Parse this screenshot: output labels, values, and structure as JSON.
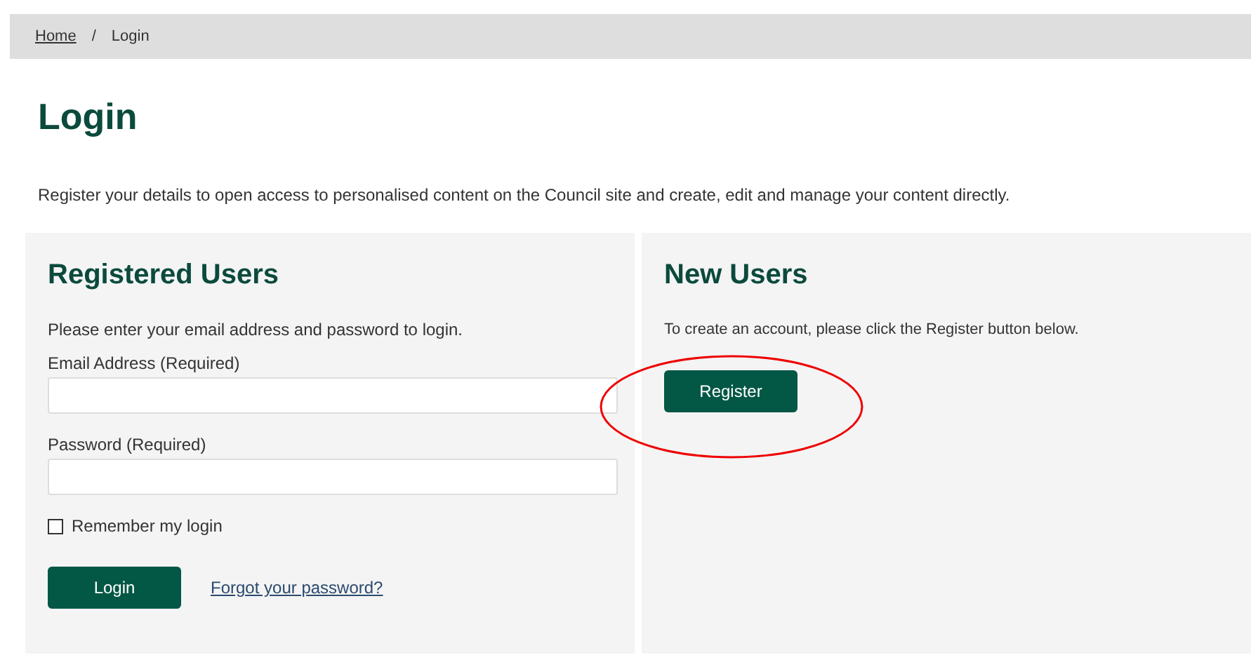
{
  "breadcrumb": [
    {
      "label": "Home",
      "link": true
    },
    {
      "label": "Login",
      "link": false
    }
  ],
  "breadcrumb_separator": "/",
  "title": "Login",
  "intro": "Register your details to open access to personalised content on the Council site and create, edit and manage your content directly.",
  "registered_users": {
    "heading": "Registered Users",
    "text": "Please enter your email address and password to login.",
    "fields": [
      {
        "label": "Email Address (Required)"
      },
      {
        "label": "Password (Required)"
      }
    ],
    "remember": {
      "label": "Remember my login",
      "checked": false
    },
    "button": "Login",
    "forgot_link": "Forgot your password?"
  },
  "new_users": {
    "heading": "New Users",
    "text": "To create an account, please click the Register button below.",
    "button": "Register",
    "highlighted": true
  }
}
